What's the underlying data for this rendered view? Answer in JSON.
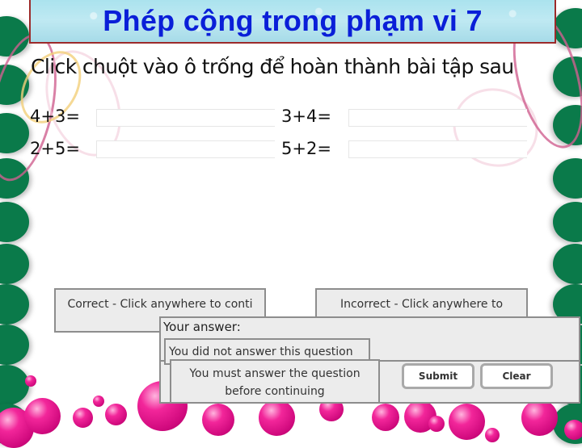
{
  "title": "Phép cộng trong phạm vi 7",
  "instruction": "Click chuột vào ô trống để hoàn thành bài tập sau",
  "exercises": [
    {
      "label": "4+3=",
      "value": ""
    },
    {
      "label": "3+4=",
      "value": ""
    },
    {
      "label": "2+5=",
      "value": ""
    },
    {
      "label": "5+2=",
      "value": ""
    }
  ],
  "feedback": {
    "correct": "Correct - Click anywhere to conti",
    "incorrect": "Incorrect - Click anywhere to"
  },
  "answer_panel": {
    "label": "Your answer:",
    "not_answered": "You did not answer this question",
    "must_answer_line1": "You must answer the question",
    "must_answer_line2": "before continuing"
  },
  "buttons": {
    "submit": "Submit",
    "clear": "Clear"
  },
  "colors": {
    "title": "#0a1fd8",
    "banner_border": "#9c2a2a",
    "leaf_green": "#0a7a4a",
    "bubble_pink": "#e0158a",
    "panel_bg": "#ececec",
    "panel_border": "#8d8d8d"
  }
}
